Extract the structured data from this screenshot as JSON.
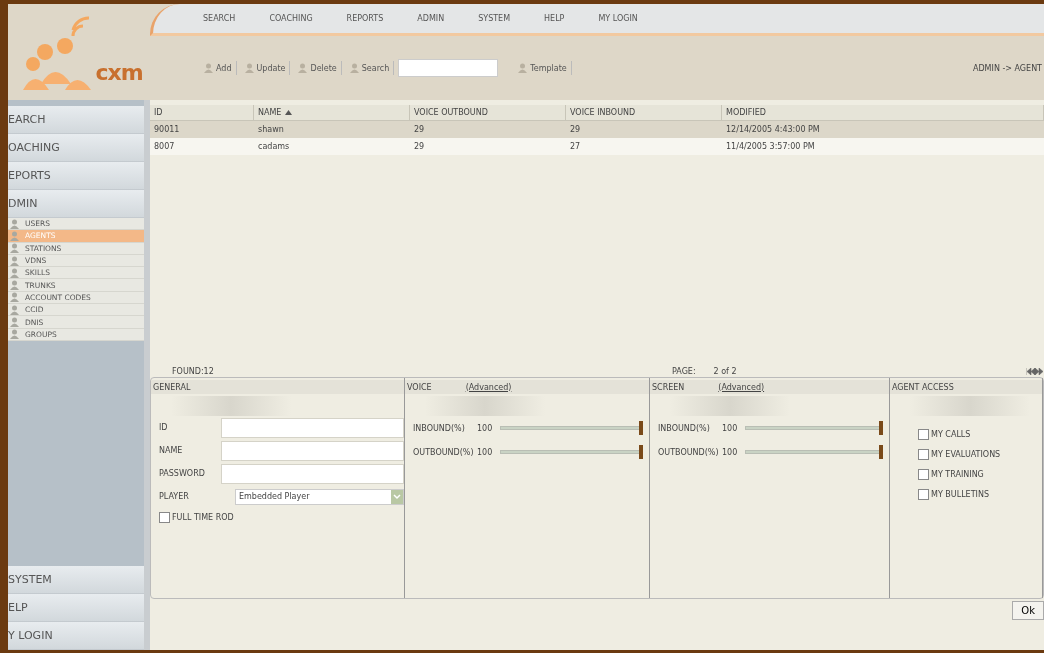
{
  "logo": {
    "text": "cxm"
  },
  "top_nav": [
    "SEARCH",
    "COACHING",
    "REPORTS",
    "ADMIN",
    "SYSTEM",
    "HELP",
    "MY LOGIN"
  ],
  "toolbar": {
    "items": [
      {
        "kind": "button",
        "label": "Add"
      },
      {
        "kind": "button",
        "label": "Update"
      },
      {
        "kind": "button",
        "label": "Delete"
      },
      {
        "kind": "button",
        "label": "Search"
      },
      {
        "kind": "field"
      },
      {
        "kind": "button",
        "label": "Template"
      }
    ]
  },
  "breadcrumb": "ADMIN -> AGENT",
  "sidebar": {
    "sections_top": [
      "EARCH",
      "OACHING",
      "EPORTS",
      "DMIN"
    ],
    "admin_items": [
      {
        "label": "USERS",
        "selected": false
      },
      {
        "label": "AGENTS",
        "selected": true
      },
      {
        "label": "STATIONS",
        "selected": false
      },
      {
        "label": "VDNS",
        "selected": false
      },
      {
        "label": "SKILLS",
        "selected": false
      },
      {
        "label": "TRUNKS",
        "selected": false
      },
      {
        "label": "ACCOUNT CODES",
        "selected": false
      },
      {
        "label": "CCID",
        "selected": false
      },
      {
        "label": "DNIS",
        "selected": false
      },
      {
        "label": "GROUPS",
        "selected": false
      }
    ],
    "sections_bottom": [
      "SYSTEM",
      "ELP",
      "Y LOGIN"
    ]
  },
  "table": {
    "columns": [
      {
        "label": "ID",
        "sorted": false
      },
      {
        "label": "NAME",
        "sorted": true
      },
      {
        "label": "VOICE OUTBOUND",
        "sorted": false
      },
      {
        "label": "VOICE INBOUND",
        "sorted": false
      },
      {
        "label": "MODIFIED",
        "sorted": false
      }
    ],
    "rows": [
      {
        "cells": [
          "90011",
          "shawn",
          "29",
          "29",
          "12/14/2005 4:43:00 PM"
        ],
        "selected": true
      },
      {
        "cells": [
          "8007",
          "cadams",
          "29",
          "27",
          "11/4/2005 3:57:00 PM"
        ],
        "selected": false
      }
    ]
  },
  "found": "FOUND:12",
  "page_label": "PAGE:",
  "page_value": "2 of 2",
  "general": {
    "title": "GENERAL",
    "fields": [
      {
        "label": "ID"
      },
      {
        "label": "NAME"
      },
      {
        "label": "PASSWORD"
      }
    ],
    "player": {
      "label": "PLAYER",
      "value": "Embedded Player"
    },
    "checkbox": {
      "label": "FULL TIME ROD",
      "checked": false
    }
  },
  "voice": {
    "title": "VOICE",
    "link": "(Advanced)",
    "sliders": [
      {
        "label": "INBOUND(%)",
        "reading": "100",
        "level": 1
      },
      {
        "label": "OUTBOUND(%)",
        "reading": "100",
        "level": 1
      }
    ]
  },
  "screen": {
    "title": "SCREEN",
    "link": "(Advanced)",
    "sliders": [
      {
        "label": "INBOUND(%)",
        "reading": "100",
        "level": 1
      },
      {
        "label": "OUTBOUND(%)",
        "reading": "100",
        "level": 1
      }
    ]
  },
  "agent_access": {
    "title": "AGENT ACCESS",
    "checkboxes": [
      {
        "label": "MY CALLS",
        "checked": false
      },
      {
        "label": "MY EVALUATIONS",
        "checked": false
      },
      {
        "label": "MY TRAINING",
        "checked": false
      },
      {
        "label": "MY BULLETINS",
        "checked": false
      }
    ]
  },
  "ok": "Ok"
}
